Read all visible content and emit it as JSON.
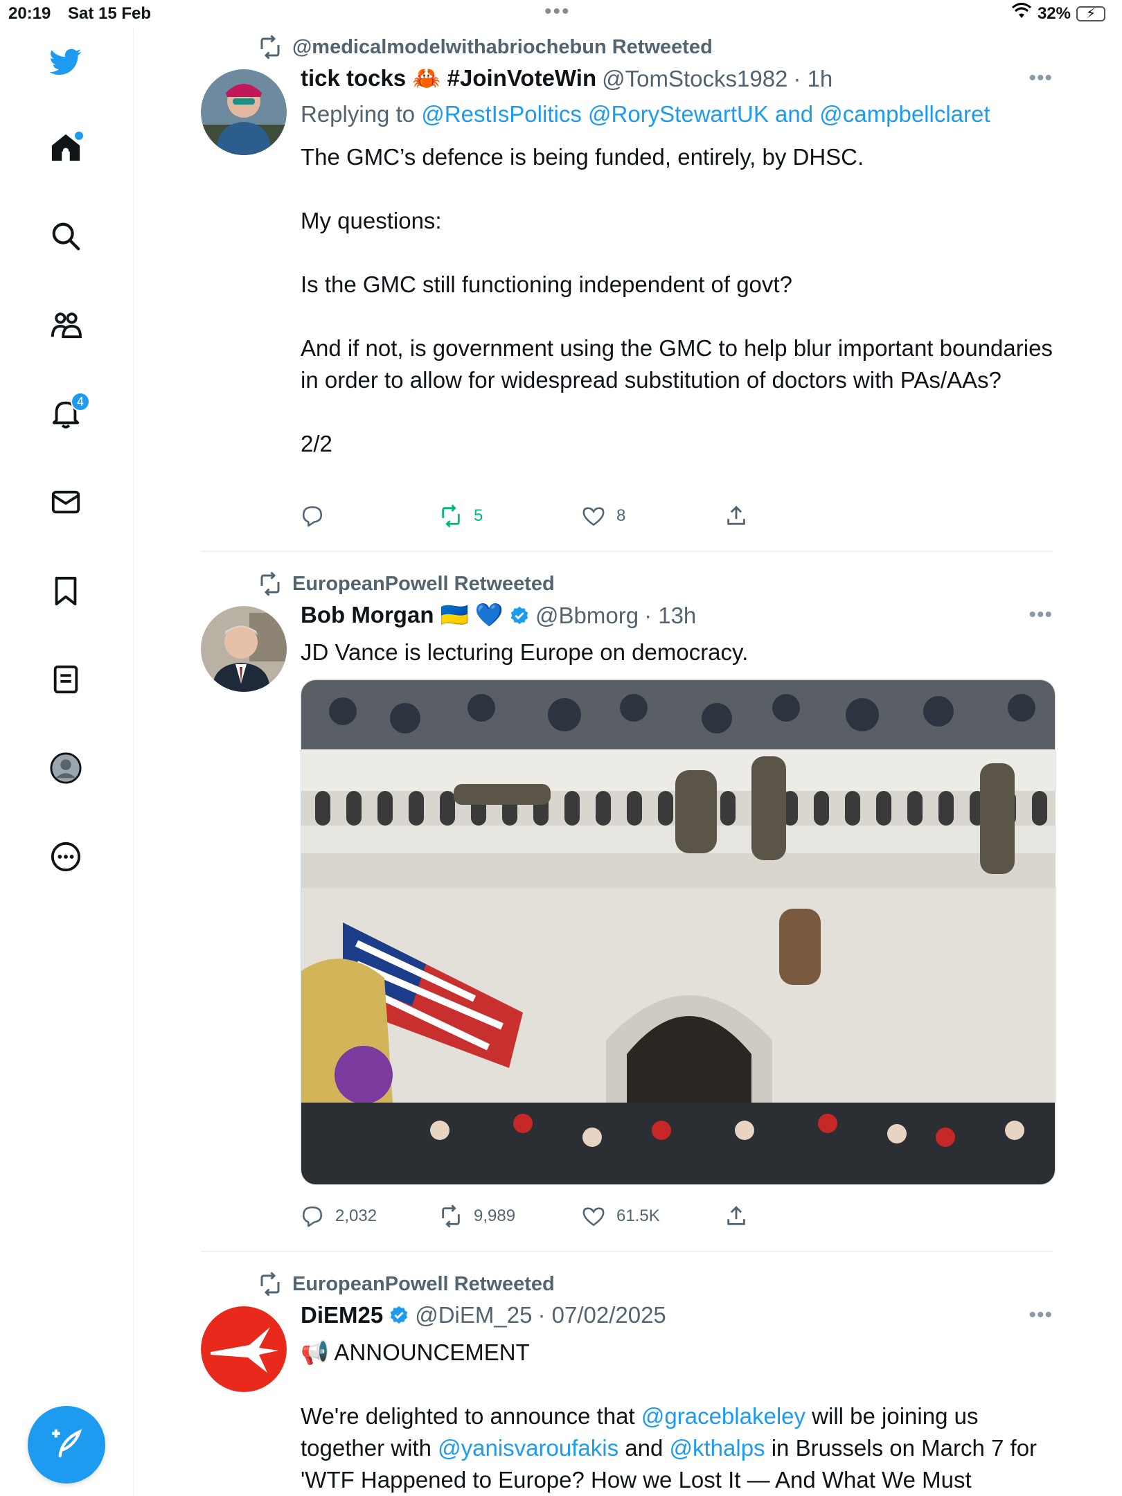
{
  "status_bar": {
    "time": "20:19",
    "date": "Sat 15 Feb",
    "battery": "32%",
    "battery_level": 0.32
  },
  "sidebar": {
    "items": [
      {
        "name": "home",
        "icon": "home-icon"
      },
      {
        "name": "explore",
        "icon": "search-icon"
      },
      {
        "name": "communities",
        "icon": "people-icon"
      },
      {
        "name": "notifications",
        "icon": "bell-icon",
        "badge": "4"
      },
      {
        "name": "messages",
        "icon": "envelope-icon"
      },
      {
        "name": "bookmarks",
        "icon": "bookmark-icon"
      },
      {
        "name": "lists",
        "icon": "list-icon"
      },
      {
        "name": "profile",
        "icon": "profile-icon"
      },
      {
        "name": "more",
        "icon": "more-circle-icon"
      }
    ]
  },
  "tweets": [
    {
      "retweeted_by": "@medicalmodelwithabriochebun Retweeted",
      "name": "tick tocks 🦀 #JoinVoteWin",
      "handle": "@TomStocks1982",
      "time": "· 1h",
      "replying_prefix": "Replying to ",
      "replying_to": "@RestIsPolitics @RoryStewartUK and @campbellclaret",
      "lines": [
        "The GMC’s defence is being funded, entirely, by DHSC.",
        "My questions:",
        "Is the GMC still functioning independent of govt?",
        "And if not, is government using the GMC to help blur important boundaries in order to allow for widespread substitution of doctors with PAs/AAs?",
        "2/2"
      ],
      "replies": "",
      "retweets": "5",
      "likes": "8"
    },
    {
      "retweeted_by": "EuropeanPowell Retweeted",
      "name": "Bob Morgan 🇺🇦 💙",
      "handle": "@Bbmorg",
      "time": "· 13h",
      "text": "JD Vance is lecturing Europe on democracy.",
      "replies": "2,032",
      "retweets": "9,989",
      "likes": "61.5K"
    },
    {
      "retweeted_by": "EuropeanPowell Retweeted",
      "name": "DiEM25",
      "handle": "@DiEM_25",
      "time": "· 07/02/2025",
      "announcement": "📢 ANNOUNCEMENT",
      "text_a": "We're delighted to announce that ",
      "mention_1": "@graceblakeley",
      "text_b": " will be joining us together with ",
      "mention_2": "@yanisvaroufakis",
      "text_c": " and ",
      "mention_3": "@kthalps",
      "text_d": " in Brussels on March 7 for 'WTF Happened to Europe? How we Lost It — And What We Must"
    }
  ],
  "colors": {
    "accent": "#1d9bf0",
    "retweet_green": "#00ba7c",
    "muted": "#536471"
  }
}
